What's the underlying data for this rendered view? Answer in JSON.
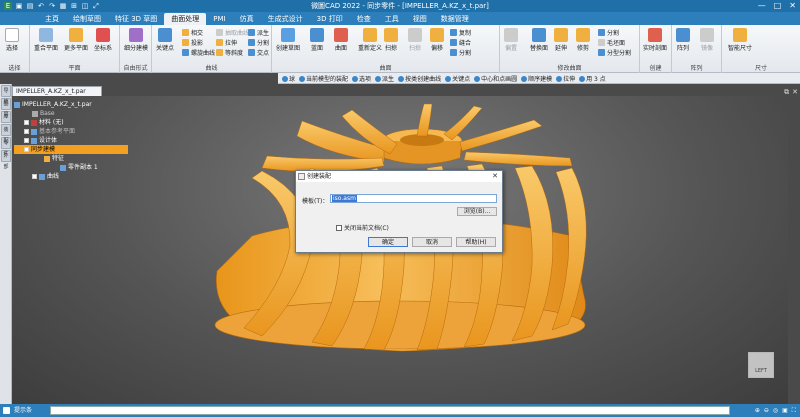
{
  "window": {
    "title": "微圖CAD 2022 - 同步零件 - [IMPELLER_A.KZ_x_t.par]",
    "controls": [
      "—",
      "□",
      "✕"
    ]
  },
  "quick_access": [
    "E",
    "▣",
    "▤",
    "↶",
    "↷",
    "▦",
    "⊞",
    "◫",
    "⤢"
  ],
  "tabs": [
    "主頁",
    "绘制草图",
    "特征 3D 草图",
    "曲面处理",
    "PMI",
    "仿真",
    "生成式设计",
    "3D 打印",
    "检查",
    "工具",
    "视图",
    "数据管理"
  ],
  "active_tab": "曲面处理",
  "ribbon": {
    "groups": [
      {
        "label": "选择",
        "buttons": [
          "选择"
        ]
      },
      {
        "label": "平面",
        "buttons": [
          "重合平面",
          "更多平面",
          "坐标系"
        ]
      },
      {
        "label": "自由形式",
        "buttons": [
          "细分建模"
        ]
      },
      {
        "label": "曲线",
        "buttons": [
          "关键点",
          "相交",
          "投影",
          "螺旋曲线",
          "抽取曲线",
          "拉伸",
          "等斜度",
          "派生",
          "分割",
          "交点"
        ]
      },
      {
        "label": "曲面",
        "buttons": [
          "创建草图",
          "旋转",
          "扫掠",
          "重新定义",
          "扫掠",
          "蓝面",
          "曲面",
          "复制",
          "偏移",
          "缝合",
          "分割"
        ]
      },
      {
        "label": "修改曲面",
        "buttons": [
          "替换面",
          "延伸",
          "修剪",
          "分割",
          "分型分割",
          "毛坯面",
          "偏置"
        ]
      },
      {
        "label": "创建",
        "buttons": [
          "实时剖面"
        ]
      },
      {
        "label": "阵列",
        "buttons": [
          "阵列",
          "镜像"
        ]
      },
      {
        "label": "尺寸",
        "buttons": [
          "智能尺寸"
        ]
      }
    ]
  },
  "selection_bar": {
    "items": [
      "球",
      "当前模型的装配",
      "选项",
      "派生",
      "按类创建曲线",
      "关键点",
      "中心和点画圆",
      "顺序建模",
      "拉伸",
      "用 3 点"
    ]
  },
  "document_tab": "IMPELLER_A.KZ_x_t.par",
  "left_toolbar": [
    "导航",
    "图层",
    "库",
    "装配",
    "零件",
    "外部"
  ],
  "tree": [
    {
      "label": "IMPELLER_A.KZ_x_t.par",
      "indent": 0,
      "highlight": false
    },
    {
      "label": "Base",
      "indent": 1,
      "highlight": false
    },
    {
      "label": "材料 (无)",
      "indent": 1,
      "highlight": false
    },
    {
      "label": "基本参考平面",
      "indent": 1,
      "highlight": false
    },
    {
      "label": "设计体",
      "indent": 1,
      "highlight": false
    },
    {
      "label": "同步建模",
      "indent": 1,
      "highlight": true
    },
    {
      "label": "特征",
      "indent": 2,
      "highlight": false
    },
    {
      "label": "零件副本 1",
      "indent": 3,
      "highlight": false
    },
    {
      "label": "曲线",
      "indent": 1,
      "highlight": false
    }
  ],
  "dialog": {
    "title": "创建装配",
    "template_label": "模板(T)：",
    "template_value": "iso.asm",
    "browse_label": "浏览(B)...",
    "checkbox_label": "关闭当前文档(C)",
    "ok_label": "确定",
    "cancel_label": "取消",
    "help_label": "帮助(H)"
  },
  "view_cube_label": "LEFT",
  "status": {
    "prompt_label": "提示条",
    "right_icons": [
      "⊕",
      "⊖",
      "◎",
      "▣",
      "⛶"
    ]
  },
  "colors": {
    "title_bar": "#1f6fa8",
    "tab_bar": "#2c7fbb",
    "model": "#f2a830",
    "tree_highlight": "#f3a021",
    "selection_blue": "#3b78d8"
  }
}
